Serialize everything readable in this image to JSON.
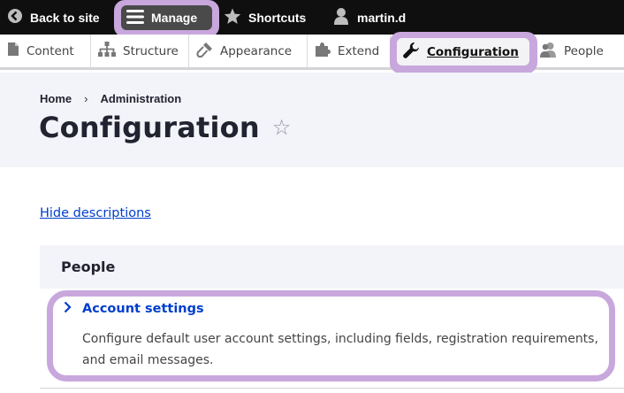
{
  "toolbar": {
    "back_label": "Back to site",
    "manage_label": "Manage",
    "shortcuts_label": "Shortcuts",
    "user_label": "martin.d"
  },
  "tray": {
    "content": "Content",
    "structure": "Structure",
    "appearance": "Appearance",
    "extend": "Extend",
    "configuration": "Configuration",
    "people": "People"
  },
  "breadcrumb": {
    "home": "Home",
    "separator": "›",
    "admin": "Administration"
  },
  "page": {
    "title": "Configuration",
    "star": "☆"
  },
  "hide_descriptions": "Hide descriptions",
  "panel": {
    "title": "People",
    "items": [
      {
        "title": "Account settings",
        "description": "Configure default user account settings, including fields, registration requirements, and email messages."
      }
    ]
  },
  "colors": {
    "highlight": "#c8a7dd",
    "link": "#003ecc",
    "toolbar": "#0f0f0f"
  }
}
